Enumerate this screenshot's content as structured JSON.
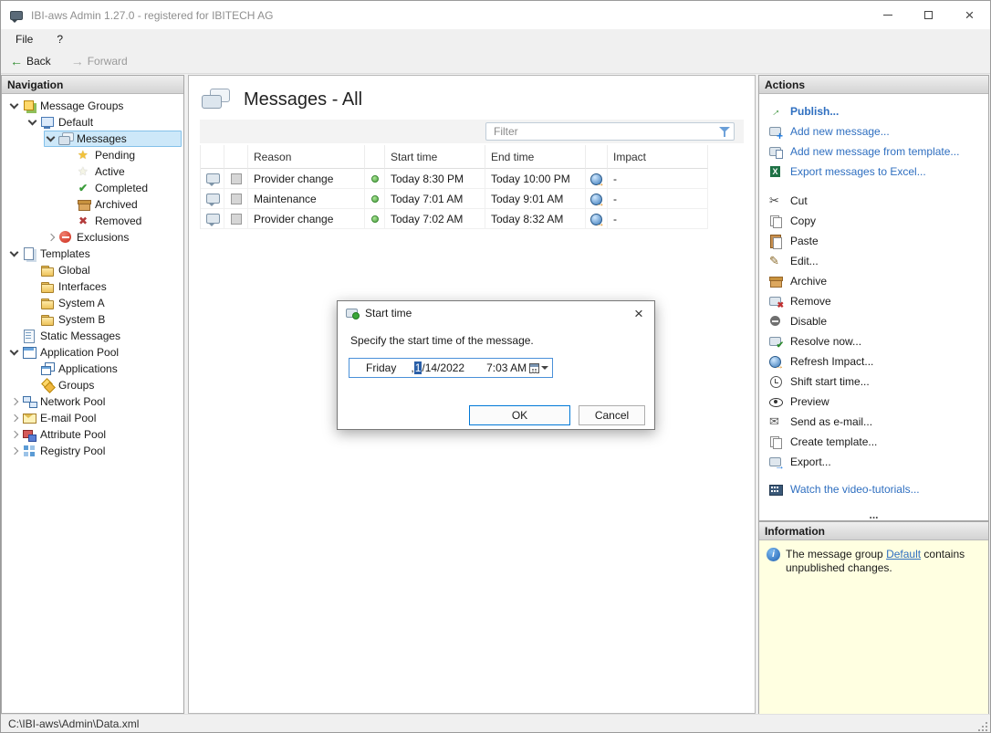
{
  "titlebar": {
    "title": "IBI-aws Admin 1.27.0 - registered for IBITECH AG"
  },
  "menubar": {
    "items": [
      "File",
      "?"
    ]
  },
  "toolbar": {
    "back": "Back",
    "forward": "Forward"
  },
  "navigation": {
    "header": "Navigation",
    "tree": [
      {
        "label": "Message Groups",
        "icon": "message-groups-icon",
        "expanded": true
      },
      {
        "label": "Default",
        "icon": "message-group-icon",
        "expanded": true
      },
      {
        "label": "Messages",
        "icon": "messages-icon",
        "expanded": true,
        "selected": true
      },
      {
        "label": "Pending",
        "icon": "pending-icon"
      },
      {
        "label": "Active",
        "icon": "active-icon"
      },
      {
        "label": "Completed",
        "icon": "completed-icon"
      },
      {
        "label": "Archived",
        "icon": "archived-icon"
      },
      {
        "label": "Removed",
        "icon": "removed-icon"
      },
      {
        "label": "Exclusions",
        "icon": "exclusions-icon",
        "expanded": false
      },
      {
        "label": "Templates",
        "icon": "templates-icon",
        "expanded": true
      },
      {
        "label": "Global",
        "icon": "folder-icon"
      },
      {
        "label": "Interfaces",
        "icon": "folder-icon"
      },
      {
        "label": "System A",
        "icon": "folder-icon"
      },
      {
        "label": "System B",
        "icon": "folder-icon"
      },
      {
        "label": "Static Messages",
        "icon": "static-messages-icon"
      },
      {
        "label": "Application Pool",
        "icon": "application-pool-icon",
        "expanded": true
      },
      {
        "label": "Applications",
        "icon": "applications-icon"
      },
      {
        "label": "Groups",
        "icon": "groups-icon"
      },
      {
        "label": "Network Pool",
        "icon": "network-pool-icon",
        "expanded": false
      },
      {
        "label": "E-mail Pool",
        "icon": "email-pool-icon",
        "expanded": false
      },
      {
        "label": "Attribute Pool",
        "icon": "attribute-pool-icon",
        "expanded": false
      },
      {
        "label": "Registry Pool",
        "icon": "registry-pool-icon",
        "expanded": false
      }
    ]
  },
  "main": {
    "title": "Messages - All",
    "filter_placeholder": "Filter",
    "table": {
      "headers": {
        "reason": "Reason",
        "start": "Start time",
        "end": "End time",
        "impact": "Impact"
      },
      "rows": [
        {
          "reason": "Provider change",
          "status": "active",
          "start": "Today 8:30 PM",
          "end": "Today 10:00 PM",
          "impact": "-"
        },
        {
          "reason": "Maintenance",
          "status": "active",
          "start": "Today 7:01 AM",
          "end": "Today 9:01 AM",
          "impact": "-"
        },
        {
          "reason": "Provider change",
          "status": "active",
          "start": "Today 7:02 AM",
          "end": "Today 8:32 AM",
          "impact": "-"
        }
      ]
    }
  },
  "dialog": {
    "title": "Start time",
    "message": "Specify the start time of the message.",
    "picker": {
      "day": "Friday",
      "comma": ",",
      "month_selected": "1",
      "date_rest": "/14/2022",
      "time": "7:03 AM"
    },
    "ok": "OK",
    "cancel": "Cancel"
  },
  "actions": {
    "header": "Actions",
    "links": [
      {
        "label": "Publish...",
        "icon": "publish-icon"
      },
      {
        "label": "Add new message...",
        "icon": "add-message-icon"
      },
      {
        "label": "Add new message from template...",
        "icon": "add-from-template-icon"
      },
      {
        "label": "Export messages to Excel...",
        "icon": "excel-icon"
      }
    ],
    "tools": [
      {
        "label": "Cut",
        "icon": "cut-icon"
      },
      {
        "label": "Copy",
        "icon": "copy-icon"
      },
      {
        "label": "Paste",
        "icon": "paste-icon"
      },
      {
        "label": "Edit...",
        "icon": "edit-icon"
      },
      {
        "label": "Archive",
        "icon": "archive-icon"
      },
      {
        "label": "Remove",
        "icon": "remove-icon"
      },
      {
        "label": "Disable",
        "icon": "disable-icon"
      },
      {
        "label": "Resolve now...",
        "icon": "resolve-icon"
      },
      {
        "label": "Refresh Impact...",
        "icon": "refresh-impact-icon"
      },
      {
        "label": "Shift start time...",
        "icon": "shift-start-time-icon"
      },
      {
        "label": "Preview",
        "icon": "preview-icon"
      },
      {
        "label": "Send as e-mail...",
        "icon": "send-email-icon"
      },
      {
        "label": "Create template...",
        "icon": "create-template-icon"
      },
      {
        "label": "Export...",
        "icon": "export-icon"
      }
    ],
    "video_link": "Watch the video-tutorials...",
    "overflow": "..."
  },
  "information": {
    "header": "Information",
    "text_before": "The message group ",
    "link": "Default",
    "text_after": " contains unpublished changes."
  },
  "statusbar": {
    "path": "C:\\IBI-aws\\Admin\\Data.xml"
  },
  "colors": {
    "accent": "#0078d7",
    "link_blue": "#2f6fc0",
    "info_bg": "#ffffe1",
    "selection_bg": "#cde8f9"
  }
}
